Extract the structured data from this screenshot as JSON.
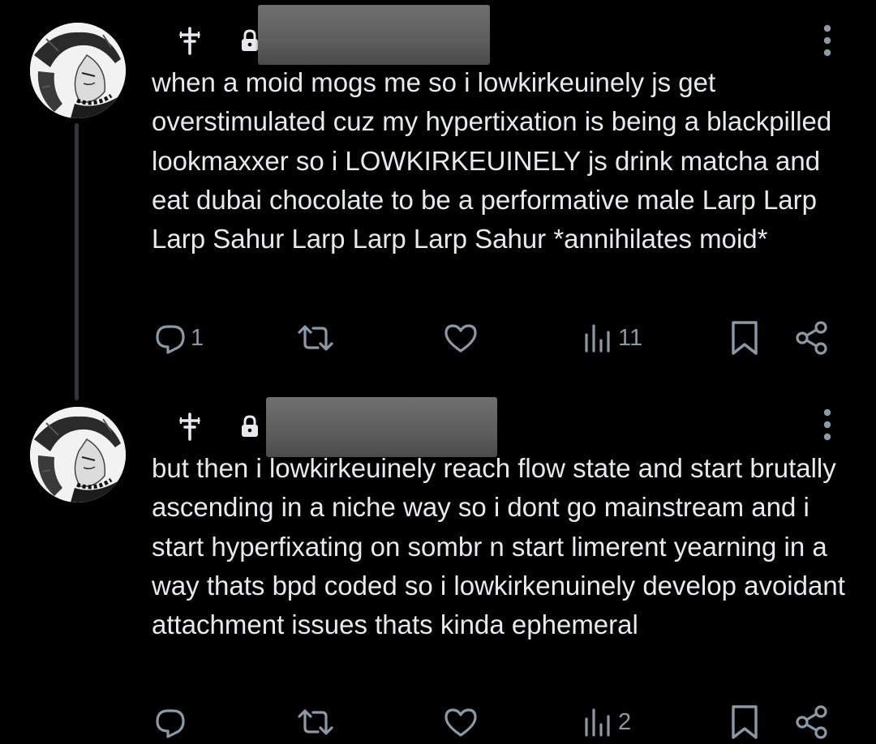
{
  "thread": {
    "posts": [
      {
        "text": "when a moid mogs me so i lowkirkeuinely js get overstimulated cuz my hypertixation is being a blackpilled lookmaxxer so i LOWKIRKEUINELY js drink matcha and eat dubai chocolate to be a performative male Larp Larp Larp Sahur Larp Larp Larp Sahur *annihilates moid*",
        "reply_count": "1",
        "views_count": "11"
      },
      {
        "text": "but then i lowkirkeuinely reach flow state and start brutally ascending in a niche way so i dont go mainstream and i start hyperfixating on sombr n start limerent yearning in a way thats bpd coded so i lowkirkenuinely develop avoidant attachment issues thats kinda ephemeral",
        "reply_count": "",
        "views_count": "2"
      }
    ]
  },
  "icons": {
    "header": [
      "cross-icon",
      "lock-icon",
      "more-icon"
    ],
    "actions": [
      "reply-icon",
      "repost-icon",
      "like-icon",
      "views-icon",
      "bookmark-icon",
      "share-icon"
    ]
  },
  "colors": {
    "background": "#000000",
    "text": "#e7e9ea",
    "secondary": "#8b98a5",
    "thread_line": "#333639",
    "redaction": "#5d5d5d"
  }
}
